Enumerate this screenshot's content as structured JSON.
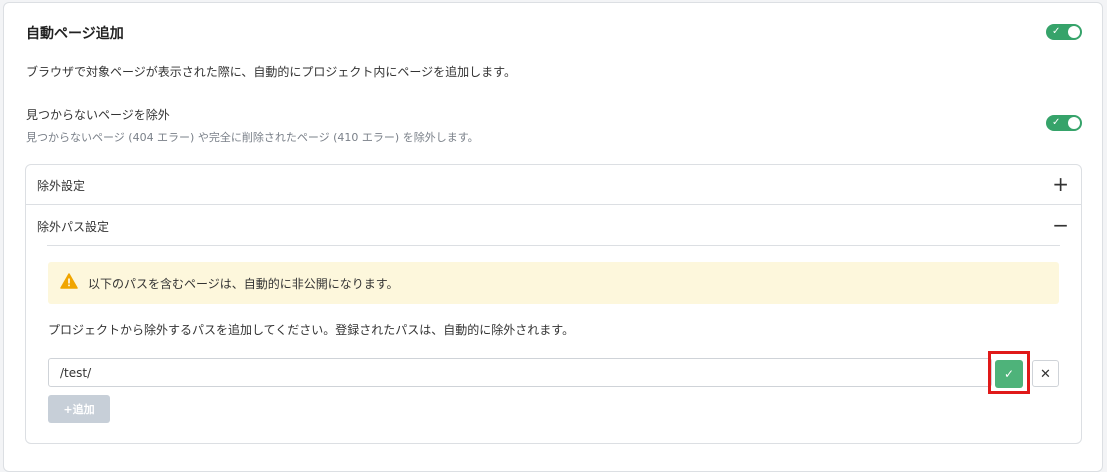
{
  "auto_add": {
    "title": "自動ページ追加",
    "description": "ブラウザで対象ページが表示された際に、自動的にプロジェクト内にページを追加します。",
    "enabled": true
  },
  "exclude_not_found": {
    "title": "見つからないページを除外",
    "description": "見つからないページ (404 エラー) や完全に削除されたページ (410 エラー) を除外します。",
    "enabled": true
  },
  "accordion": {
    "items": [
      {
        "label": "除外設定",
        "icon": "plus-icon",
        "glyph": "+",
        "expanded": false
      },
      {
        "label": "除外パス設定",
        "icon": "minus-icon",
        "glyph": "−",
        "expanded": true
      }
    ]
  },
  "exclude_paths": {
    "alert_text": "以下のパスを含むページは、自動的に非公開になります。",
    "help_text": "プロジェクトから除外するパスを追加してください。登録されたパスは、自動的に除外されます。",
    "path_value": "/test/",
    "confirm_glyph": "✓",
    "cancel_glyph": "✕",
    "add_label": "+追加"
  },
  "colors": {
    "toggle_on": "#36a36a",
    "confirm": "#4eb37a",
    "alert_bg": "#fdf7dc",
    "warning": "#f0a500",
    "highlight": "#e01919",
    "add_disabled": "#c7cfd8"
  }
}
